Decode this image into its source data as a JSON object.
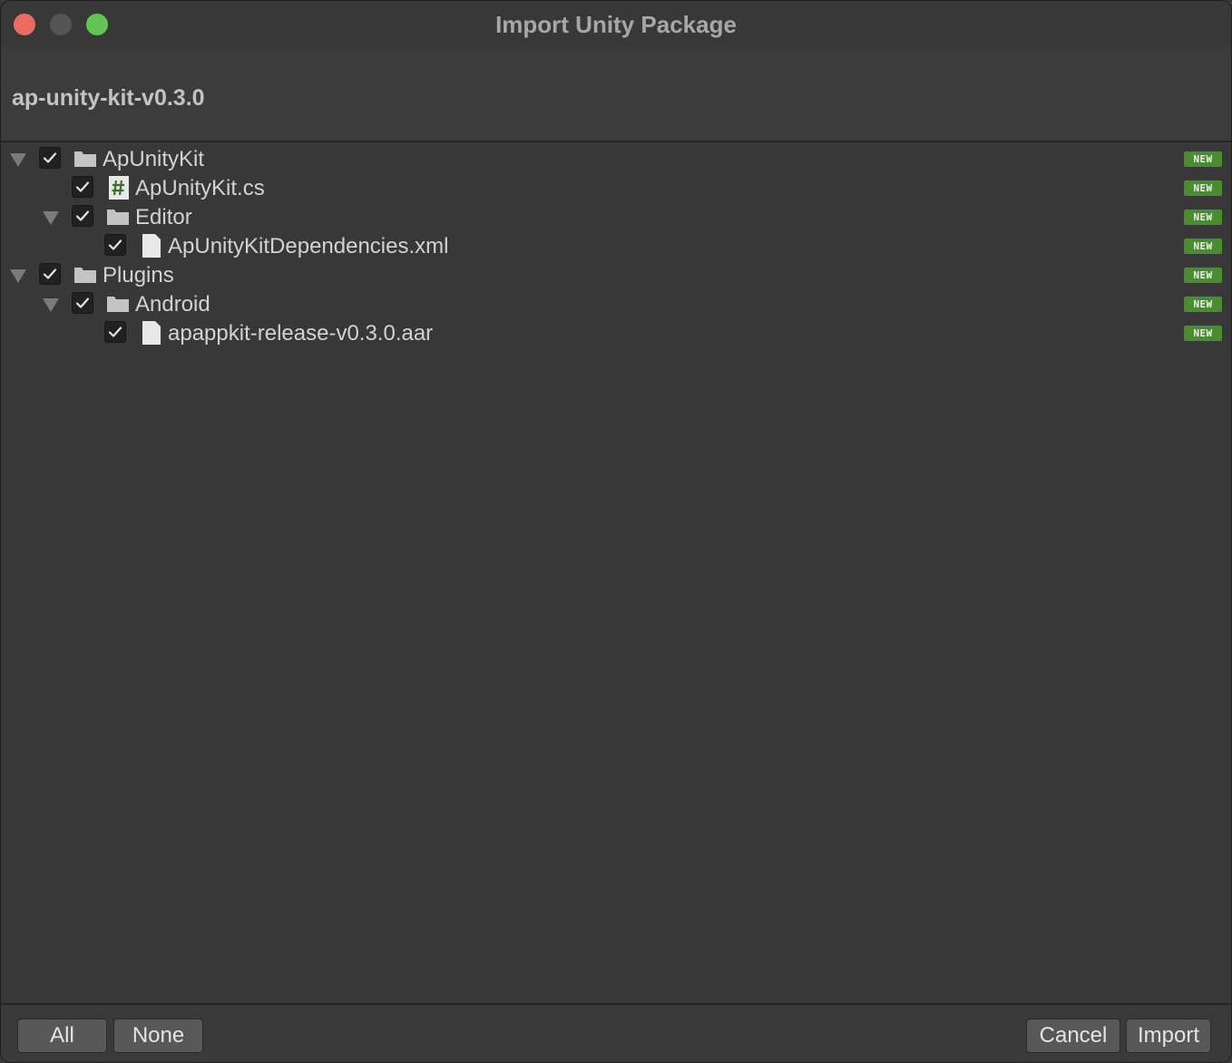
{
  "window": {
    "title": "Import Unity Package"
  },
  "package": {
    "name": "ap-unity-kit-v0.3.0"
  },
  "tree": {
    "badge_label": "NEW",
    "items": [
      {
        "name": "ApUnityKit",
        "kind": "folder",
        "expanded": true,
        "checked": true,
        "icon": "folder-icon"
      },
      {
        "name": "ApUnityKit.cs",
        "kind": "script",
        "checked": true,
        "icon": "csharp-script-icon"
      },
      {
        "name": "Editor",
        "kind": "folder",
        "expanded": true,
        "checked": true,
        "icon": "folder-icon"
      },
      {
        "name": "ApUnityKitDependencies.xml",
        "kind": "file",
        "checked": true,
        "icon": "file-icon"
      },
      {
        "name": "Plugins",
        "kind": "folder",
        "expanded": true,
        "checked": true,
        "icon": "folder-icon"
      },
      {
        "name": "Android",
        "kind": "folder",
        "expanded": true,
        "checked": true,
        "icon": "folder-icon"
      },
      {
        "name": "apappkit-release-v0.3.0.aar",
        "kind": "file",
        "checked": true,
        "icon": "file-icon"
      }
    ]
  },
  "footer": {
    "all_label": "All",
    "none_label": "None",
    "cancel_label": "Cancel",
    "import_label": "Import"
  },
  "colors": {
    "background": "#383838",
    "badge": "#4a8c2f",
    "close": "#ec6a5f",
    "maximize": "#61c554",
    "text": "#d2d2d2"
  }
}
